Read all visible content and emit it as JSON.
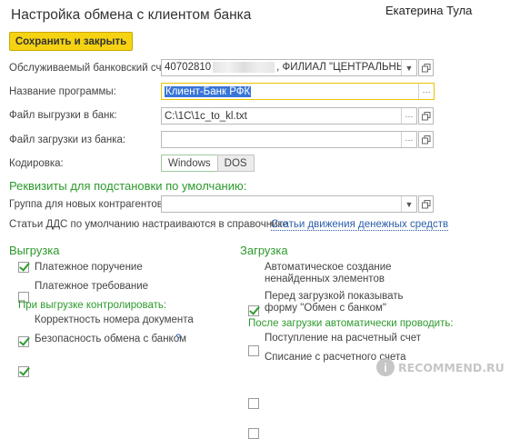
{
  "window": {
    "title": "Настройка обмена с клиентом банка",
    "user": "Екатерина Тула"
  },
  "toolbar": {
    "save_close_label": "Сохранить и закрыть"
  },
  "form": {
    "bank_account": {
      "label": "Обслуживаемый банковский счет:",
      "value_prefix": "40702810",
      "value_suffix": ", ФИЛИАЛ \"ЦЕНТРАЛЬНЫЙ\""
    },
    "program_name": {
      "label": "Название программы:",
      "value": "Клиент-Банк РФК"
    },
    "export_file": {
      "label": "Файл выгрузки в банк:",
      "value": "C:\\1C\\1c_to_kl.txt"
    },
    "import_file": {
      "label": "Файл загрузки из банка:",
      "value": ""
    },
    "encoding": {
      "label": "Кодировка:",
      "options": [
        "Windows",
        "DOS"
      ],
      "selected": "Windows"
    }
  },
  "defaults": {
    "heading": "Реквизиты для подстановки по умолчанию:",
    "group_label": "Группа для новых контрагентов:",
    "group_value": "",
    "dds_text": "Статьи ДДС по умолчанию настраиваются в справочнике",
    "dds_link": "Статьи движения денежных средств"
  },
  "export_section": {
    "heading": "Выгрузка",
    "items": [
      {
        "label": "Платежное поручение",
        "checked": true
      },
      {
        "label": "Платежное требование",
        "checked": false
      }
    ],
    "control_heading": "При выгрузке контролировать:",
    "control_items": [
      {
        "label": "Корректность номера документа",
        "checked": true
      },
      {
        "label": "Безопасность обмена с банком",
        "checked": true
      }
    ],
    "help": "?"
  },
  "import_section": {
    "heading": "Загрузка",
    "items": [
      {
        "label_line1": "Автоматическое создание",
        "label_line2": "ненайденных элементов",
        "checked": true
      },
      {
        "label_line1": "Перед загрузкой показывать",
        "label_line2": "форму \"Обмен с банком\"",
        "checked": false
      }
    ],
    "auto_heading": "После загрузки автоматически проводить:",
    "auto_items": [
      {
        "label": "Поступление на расчетный счет",
        "checked": false
      },
      {
        "label": "Списание с расчетного счета",
        "checked": false
      }
    ]
  },
  "watermark": {
    "letter": "i",
    "text": "RECOMMEND.RU"
  },
  "colors": {
    "save_button": "#f5d312",
    "section_green": "#2c9a2c",
    "link_blue": "#2b5ea8",
    "selection": "#3875d7"
  },
  "icons": [
    "dropdown-arrow-icon",
    "open-window-icon",
    "ellipsis-icon",
    "help-icon",
    "checkmark-icon"
  ]
}
